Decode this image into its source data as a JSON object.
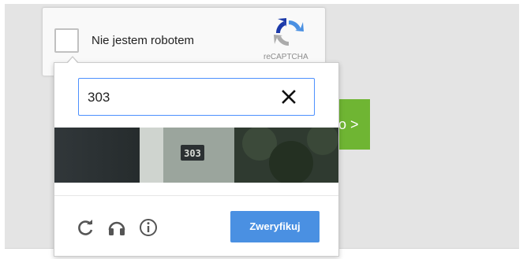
{
  "background_button": {
    "label": "o >"
  },
  "recaptcha": {
    "checkbox_label": "Nie jestem robotem",
    "logo_text": "reCAPTCHA"
  },
  "challenge": {
    "input_value": "303",
    "image_text": "303",
    "verify_label": "Zweryfikuj"
  },
  "icons": {
    "reload": "reload-icon",
    "audio": "headphones-icon",
    "info": "info-icon",
    "clear": "close-icon"
  },
  "colors": {
    "accent": "#4a90e2",
    "input_focus": "#4d90fe",
    "behind_button": "#6fb533"
  }
}
